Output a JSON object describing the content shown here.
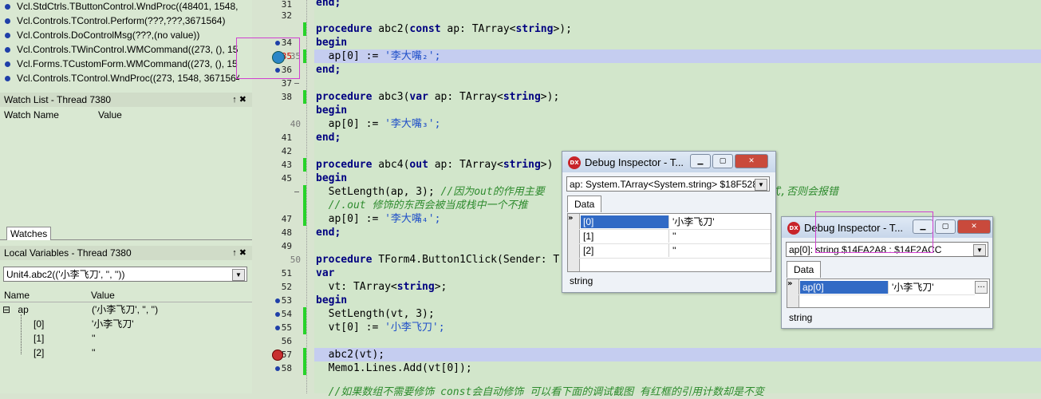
{
  "call_stack": {
    "items": [
      "Vcl.StdCtrls.TButtonControl.WndProc((48401, 1548,",
      "Vcl.Controls.TControl.Perform(???,???,3671564)",
      "Vcl.Controls.DoControlMsg(???,(no value))",
      "Vcl.Controls.TWinControl.WMCommand((273, (), 15",
      "Vcl.Forms.TCustomForm.WMCommand((273, (), 15",
      "Vcl.Controls.TControl.WndProc((273, 1548, 3671564,"
    ]
  },
  "watch_list": {
    "title": "Watch List - Thread 7380",
    "col_name": "Watch Name",
    "col_value": "Value",
    "tab": "Watches",
    "pin": "↑",
    "close": "✖"
  },
  "local_vars": {
    "title": "Local Variables - Thread 7380",
    "scope": "Unit4.abc2(('小李飞刀', '', ''))",
    "col_name": "Name",
    "col_value": "Value",
    "rows": [
      {
        "expander": "⊟",
        "name": "ap",
        "value": "('小李飞刀', '', '')"
      },
      {
        "name": "[0]",
        "value": "'小李飞刀'"
      },
      {
        "name": "[1]",
        "value": "''"
      },
      {
        "name": "[2]",
        "value": "''"
      }
    ]
  },
  "editor": {
    "line_numbers": [
      "31",
      "32",
      "34",
      "35",
      "36",
      "37",
      "38",
      "40",
      "41",
      "42",
      "43",
      "45",
      "",
      "47",
      "48",
      "49",
      "50",
      "51",
      "52",
      "53",
      "54",
      "55",
      "56",
      "57",
      "58"
    ],
    "gutter_hint_35": "35",
    "code": {
      "l31": "end;",
      "l33a": "procedure",
      "l33b": " abc2(",
      "l33c": "const",
      "l33d": " ap: TArray<",
      "l33e": "string",
      "l33f": ">);",
      "l34": "begin",
      "l35a": "  ap[0] := ",
      "l35b": "'李大嘴₂';",
      "l36": "end;",
      "l38a": "procedure",
      "l38b": " abc3(",
      "l38c": "var",
      "l38d": " ap: TArray<",
      "l38e": "string",
      "l38f": ">);",
      "l39": "begin",
      "l40a": "  ap[0] := ",
      "l40b": "'李大嘴₃';",
      "l41": "end;",
      "l43a": "procedure",
      "l43b": " abc4(",
      "l43c": "out",
      "l43d": " ap: TArray<",
      "l43e": "string",
      "l43f": ">)",
      "l44": "begin",
      "l45a": "  SetLength(ap, 3); ",
      "l45b": "//因为out的作用主要",
      "l45c": "式,否则会报错",
      "l46": "  //.out 修饰的东西会被当成栈中一个不推",
      "l47a": "  ap[0] := ",
      "l47b": "'李大嘴₄';",
      "l48": "end;",
      "l50a": "procedure",
      "l50b": " TForm4.Button1Click(Sender: T",
      "l51": "var",
      "l52a": "  vt: TArray<",
      "l52b": "string",
      "l52c": ">;",
      "l53": "begin",
      "l54": "  SetLength(vt, 3);",
      "l55a": "  vt[0] := ",
      "l55b": "'小李飞刀';",
      "l57": "  abc2(vt);",
      "l58": "  Memo1.Lines.Add(vt[0]);",
      "l59": "  //如果数组不需要修饰 const会自动修饰 可以看下面的调试截图 有红框的引用计数却是不变"
    }
  },
  "inspector1": {
    "icon": "DX",
    "title": "Debug Inspector - T...",
    "expr": "ap: System.TArray<System.string> $18F528",
    "tab": "Data",
    "rows": [
      {
        "name": "[0]",
        "value": "'小李飞刀'"
      },
      {
        "name": "[1]",
        "value": "''"
      },
      {
        "name": "[2]",
        "value": "''"
      }
    ],
    "status": "string"
  },
  "inspector2": {
    "icon": "DX",
    "title": "Debug Inspector - T...",
    "expr": "ap[0]: string $14FA2A8 : $14F2ACC",
    "tab": "Data",
    "rows": [
      {
        "name": "ap[0]",
        "value": "'小李飞刀'"
      }
    ],
    "ellipsis": "...",
    "status": "string"
  },
  "colors": {
    "accent": "#316ac5",
    "highlight": "#c5cdf0",
    "modified": "#27d32a",
    "annotation": "#d040d0"
  }
}
